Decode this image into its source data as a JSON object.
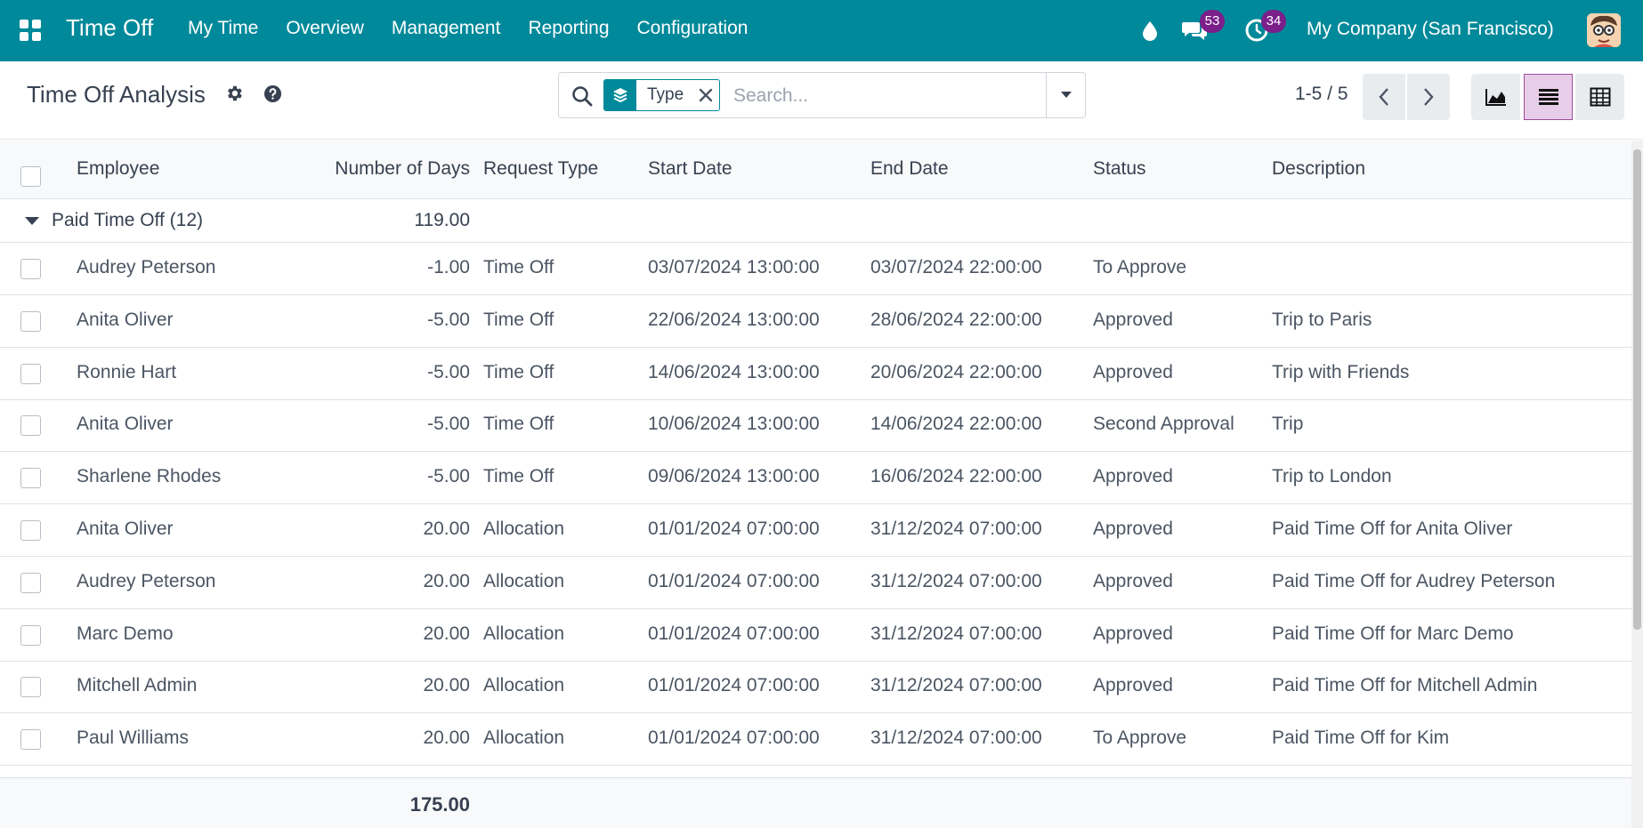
{
  "navbar": {
    "app_title": "Time Off",
    "menu": [
      "My Time",
      "Overview",
      "Management",
      "Reporting",
      "Configuration"
    ],
    "messages_badge": "53",
    "activities_badge": "34",
    "company": "My Company (San Francisco)"
  },
  "control": {
    "title": "Time Off Analysis",
    "facet_label": "Type",
    "search_placeholder": "Search...",
    "pager": "1-5 / 5"
  },
  "table": {
    "headers": [
      "Employee",
      "Number of Days",
      "Request Type",
      "Start Date",
      "End Date",
      "Status",
      "Description"
    ],
    "group": {
      "label": "Paid Time Off (12)",
      "total": "119.00"
    },
    "rows": [
      {
        "employee": "Audrey Peterson",
        "days": "-1.00",
        "type": "Time Off",
        "start": "03/07/2024 13:00:00",
        "end": "03/07/2024 22:00:00",
        "status": "To Approve",
        "desc": ""
      },
      {
        "employee": "Anita Oliver",
        "days": "-5.00",
        "type": "Time Off",
        "start": "22/06/2024 13:00:00",
        "end": "28/06/2024 22:00:00",
        "status": "Approved",
        "desc": "Trip to Paris"
      },
      {
        "employee": "Ronnie Hart",
        "days": "-5.00",
        "type": "Time Off",
        "start": "14/06/2024 13:00:00",
        "end": "20/06/2024 22:00:00",
        "status": "Approved",
        "desc": "Trip with Friends"
      },
      {
        "employee": "Anita Oliver",
        "days": "-5.00",
        "type": "Time Off",
        "start": "10/06/2024 13:00:00",
        "end": "14/06/2024 22:00:00",
        "status": "Second Approval",
        "desc": "Trip"
      },
      {
        "employee": "Sharlene Rhodes",
        "days": "-5.00",
        "type": "Time Off",
        "start": "09/06/2024 13:00:00",
        "end": "16/06/2024 22:00:00",
        "status": "Approved",
        "desc": "Trip to London"
      },
      {
        "employee": "Anita Oliver",
        "days": "20.00",
        "type": "Allocation",
        "start": "01/01/2024 07:00:00",
        "end": "31/12/2024 07:00:00",
        "status": "Approved",
        "desc": "Paid Time Off for Anita Oliver"
      },
      {
        "employee": "Audrey Peterson",
        "days": "20.00",
        "type": "Allocation",
        "start": "01/01/2024 07:00:00",
        "end": "31/12/2024 07:00:00",
        "status": "Approved",
        "desc": "Paid Time Off for Audrey Peterson"
      },
      {
        "employee": "Marc Demo",
        "days": "20.00",
        "type": "Allocation",
        "start": "01/01/2024 07:00:00",
        "end": "31/12/2024 07:00:00",
        "status": "Approved",
        "desc": "Paid Time Off for Marc Demo"
      },
      {
        "employee": "Mitchell Admin",
        "days": "20.00",
        "type": "Allocation",
        "start": "01/01/2024 07:00:00",
        "end": "31/12/2024 07:00:00",
        "status": "Approved",
        "desc": "Paid Time Off for Mitchell Admin"
      },
      {
        "employee": "Paul Williams",
        "days": "20.00",
        "type": "Allocation",
        "start": "01/01/2024 07:00:00",
        "end": "31/12/2024 07:00:00",
        "status": "To Approve",
        "desc": "Paid Time Off for Kim"
      }
    ],
    "footer_total": "175.00"
  }
}
